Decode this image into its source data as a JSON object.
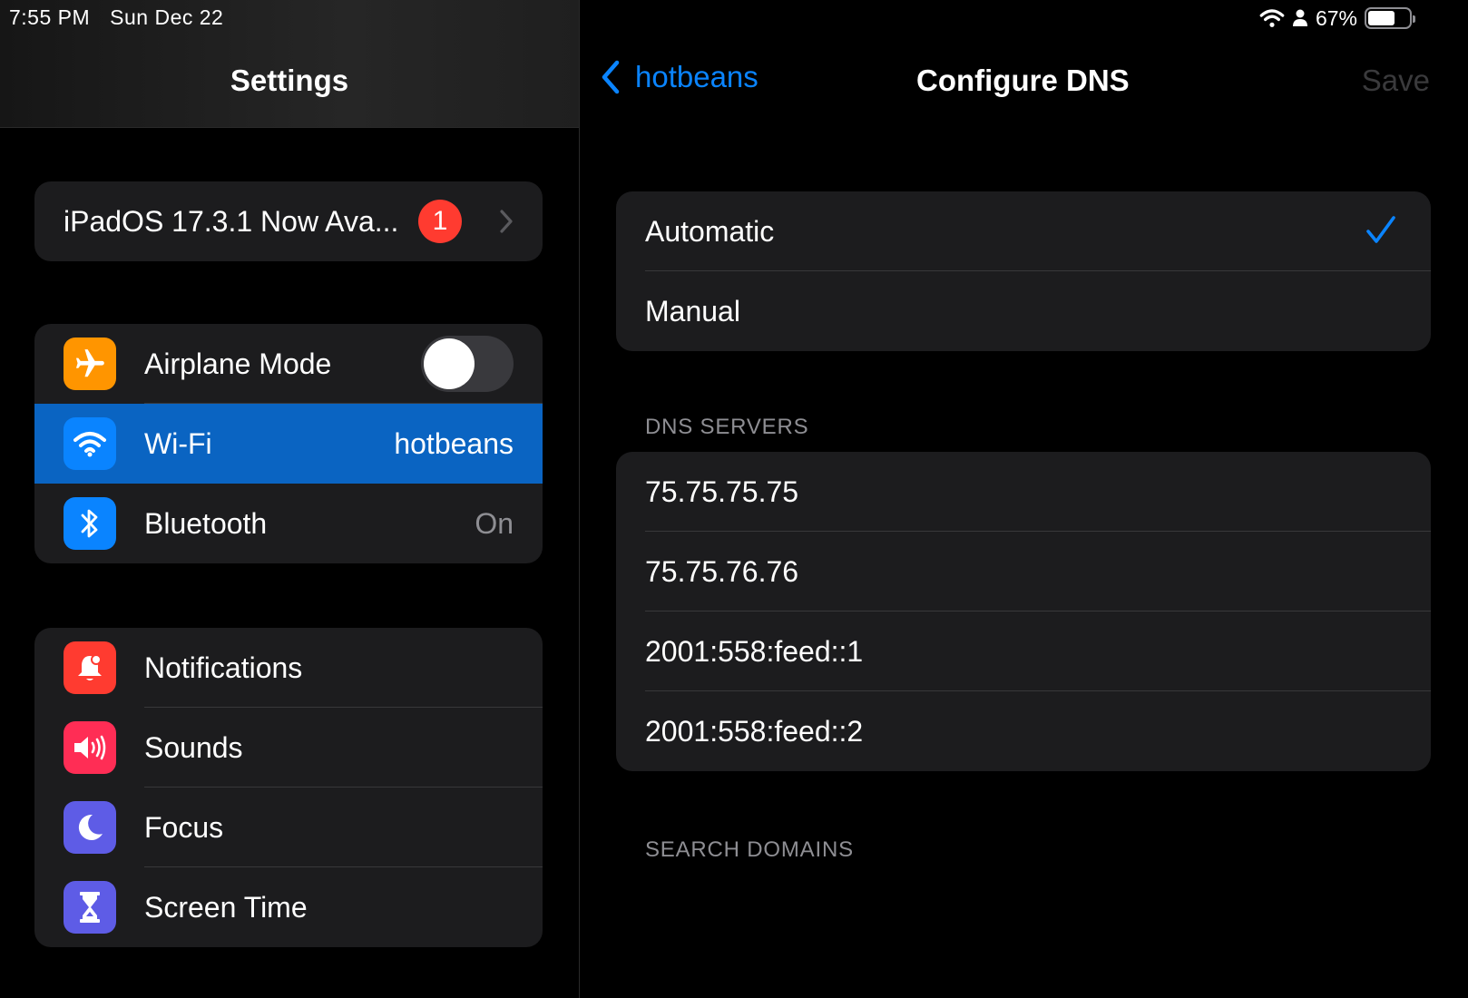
{
  "status_bar": {
    "time": "7:55 PM",
    "date": "Sun Dec 22",
    "battery_percent": "67%",
    "battery_level": 0.67,
    "icons": [
      "wifi-icon",
      "person-icon",
      "battery-icon"
    ]
  },
  "sidebar": {
    "title": "Settings",
    "update": {
      "label": "iPadOS 17.3.1 Now Ava...",
      "badge": "1"
    },
    "connectivity": [
      {
        "label": "Airplane Mode",
        "icon": "airplane-icon",
        "color": "#ff9500",
        "toggle": false
      },
      {
        "label": "Wi-Fi",
        "icon": "wifi-icon",
        "color": "#0a84ff",
        "value": "hotbeans",
        "selected": true
      },
      {
        "label": "Bluetooth",
        "icon": "bluetooth-icon",
        "color": "#0a84ff",
        "value": "On"
      }
    ],
    "general": [
      {
        "label": "Notifications",
        "icon": "bell-icon",
        "color": "#ff3b30"
      },
      {
        "label": "Sounds",
        "icon": "speaker-icon",
        "color": "#ff2d55"
      },
      {
        "label": "Focus",
        "icon": "moon-icon",
        "color": "#5e5ce6"
      },
      {
        "label": "Screen Time",
        "icon": "hourglass-icon",
        "color": "#5e5ce6"
      }
    ]
  },
  "detail": {
    "back_label": "hotbeans",
    "title": "Configure DNS",
    "save_label": "Save",
    "mode_options": [
      {
        "label": "Automatic",
        "checked": true
      },
      {
        "label": "Manual",
        "checked": false
      }
    ],
    "dns_header": "DNS SERVERS",
    "dns_servers": [
      "75.75.75.75",
      "75.75.76.76",
      "2001:558:feed::1",
      "2001:558:feed::2"
    ],
    "search_header": "SEARCH DOMAINS"
  },
  "colors": {
    "accent": "#0a84ff",
    "selected_row": "#0a64c2",
    "group_bg": "#1c1c1e",
    "badge": "#ff3b30"
  }
}
